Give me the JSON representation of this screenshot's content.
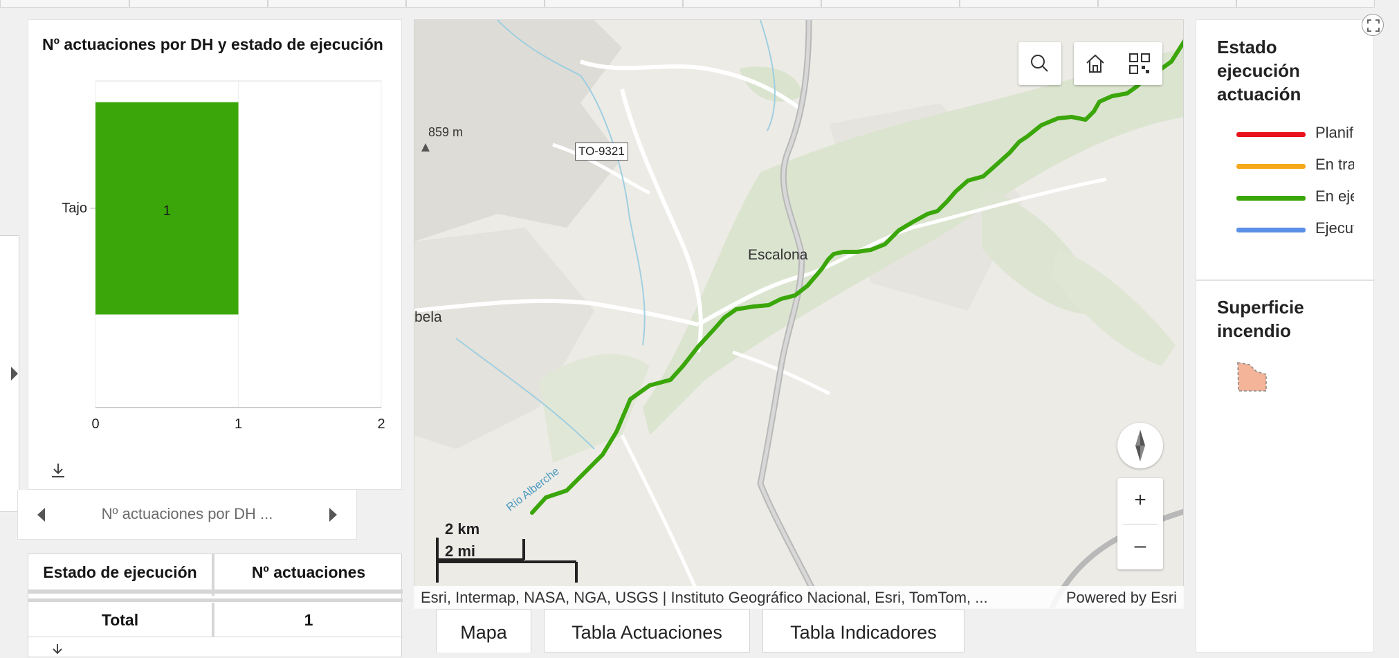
{
  "chart_data": {
    "type": "bar",
    "orientation": "horizontal",
    "title": "Nº actuaciones por DH y estado de ejecución",
    "categories": [
      "Tajo"
    ],
    "series": [
      {
        "values": [
          1
        ],
        "color": "#3aa60a"
      }
    ],
    "data_labels": [
      "1"
    ],
    "xlim": [
      0,
      2
    ],
    "xticks": [
      "0",
      "1",
      "2"
    ]
  },
  "chart_pager": {
    "label": "Nº actuaciones por DH ..."
  },
  "table": {
    "headers": [
      "Estado de ejecución",
      "Nº actuaciones"
    ],
    "total_label": "Total",
    "total_value": "1"
  },
  "map": {
    "labels": {
      "town": "Escalona",
      "west_town": "bela",
      "peak": "859 m",
      "road": "TO-9321",
      "river": "Río Alberche"
    },
    "scale": {
      "km": "2 km",
      "mi": "2 mi"
    },
    "attribution": "Esri, Intermap, NASA, NGA, USGS | Instituto Geográfico Nacional, Esri, TomTom, ...",
    "powered_by": "Powered by Esri",
    "zoom_in": "+",
    "zoom_out": "–"
  },
  "tabs": [
    "Mapa",
    "Tabla Actuaciones",
    "Tabla Indicadores"
  ],
  "legend": {
    "section1_title_lines": [
      "Estado",
      "ejecución",
      "actuación"
    ],
    "items": [
      {
        "label": "Planificada",
        "color": "#e8131d"
      },
      {
        "label": "En tramitación",
        "color": "#f5a81c"
      },
      {
        "label": "En ejecución",
        "color": "#3aa60a"
      },
      {
        "label": "Ejecutada",
        "color": "#5b8fe8"
      }
    ],
    "section2_title_lines": [
      "Superficie",
      "incendio"
    ],
    "fire_color": "#f3b49a"
  }
}
